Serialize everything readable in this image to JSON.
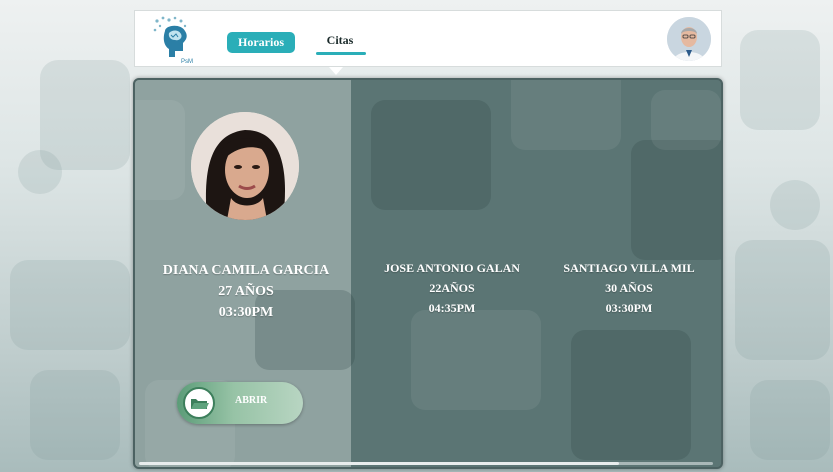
{
  "nav": {
    "logo_text": "PsM",
    "tabs": [
      {
        "label": "Horarios",
        "active": false
      },
      {
        "label": "Citas",
        "active": true
      }
    ]
  },
  "patients": [
    {
      "name": "DIANA CAMILA GARCIA",
      "age": "27 AÑOS",
      "time": "03:30PM",
      "selected": true
    },
    {
      "name": "JOSE ANTONIO GALAN",
      "age": "22AÑOS",
      "time": "04:35PM",
      "selected": false
    },
    {
      "name": "SANTIAGO VILLA MIL",
      "age": "30 AÑOS",
      "time": "03:30PM",
      "selected": false
    }
  ],
  "actions": {
    "open_label": "ABRIR"
  },
  "colors": {
    "accent": "#2aaeb8",
    "panel_dark": "#5b7574",
    "panel_selected": "#8fa2a0",
    "button_green": "#5b9c78"
  },
  "icons": {
    "logo": "brain-head-icon",
    "open": "folder-icon"
  }
}
